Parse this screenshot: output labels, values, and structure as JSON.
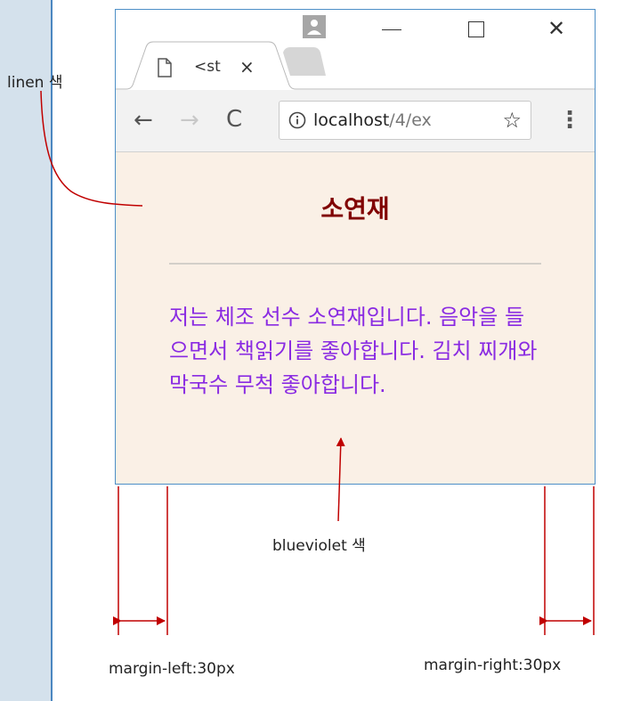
{
  "browser": {
    "tab_title": "<st",
    "tab_close": "×",
    "url_host": "localhost",
    "url_path": "/4/ex",
    "icons": [
      "profile-icon",
      "minimize-icon",
      "maximize-icon",
      "close-icon",
      "file-icon",
      "back-icon",
      "forward-icon",
      "reload-icon",
      "info-icon",
      "star-icon",
      "menu-icon"
    ]
  },
  "page": {
    "title": "소연재",
    "text": "저는 체조 선수 소연재입니다. 음악을 들으면서 책읽기를 좋아합니다. 김치 찌개와 막국수 무척 좋아합니다.",
    "background_color": "#faf0e6",
    "title_color": "#800000",
    "text_color": "#8a2be2"
  },
  "annotations": {
    "linen": "linen 색",
    "blueviolet": "blueviolet 색",
    "margin_left": "margin-left:30px",
    "margin_right": "margin-right:30px",
    "arrow_color": "#c00000"
  }
}
